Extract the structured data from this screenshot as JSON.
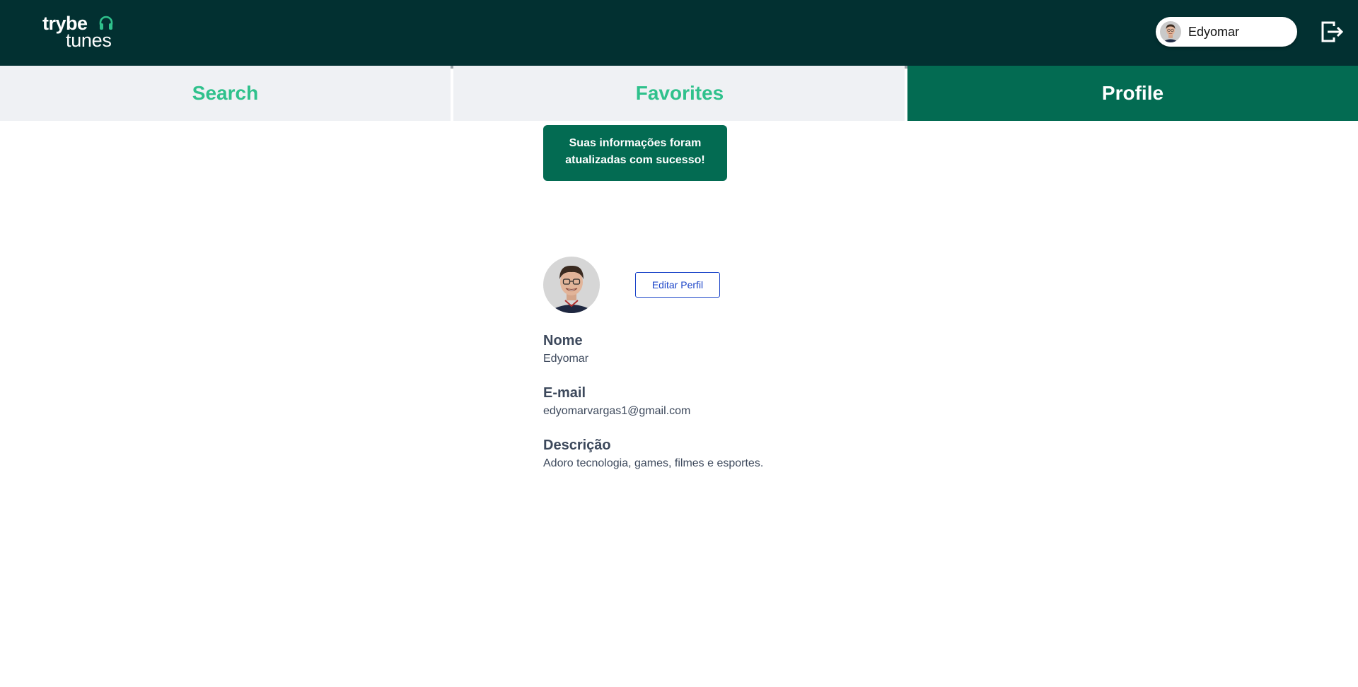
{
  "header": {
    "logo_line1": "trybe",
    "logo_line2": "tunes",
    "logo_icon": "headphones-icon",
    "user_name": "Edyomar",
    "logout_icon": "logout-icon",
    "background_color": "#023031"
  },
  "tabs": [
    {
      "label": "Search",
      "active": false
    },
    {
      "label": "Favorites",
      "active": false
    },
    {
      "label": "Profile",
      "active": true
    }
  ],
  "toast": {
    "line1": "Suas informações foram",
    "line2": "atualizadas com sucesso!"
  },
  "profile": {
    "edit_label": "Editar Perfil",
    "fields": [
      {
        "label": "Nome",
        "value": "Edyomar"
      },
      {
        "label": "E-mail",
        "value": "edyomarvargas1@gmail.com"
      },
      {
        "label": "Descrição",
        "value": "Adoro tecnologia, games, filmes e esportes."
      }
    ]
  },
  "colors": {
    "accent_green": "#2fc18c",
    "active_tab": "#036b52",
    "tab_background": "#eff1f4",
    "text_dark": "#3d495c",
    "link_blue": "#1b44c8"
  }
}
